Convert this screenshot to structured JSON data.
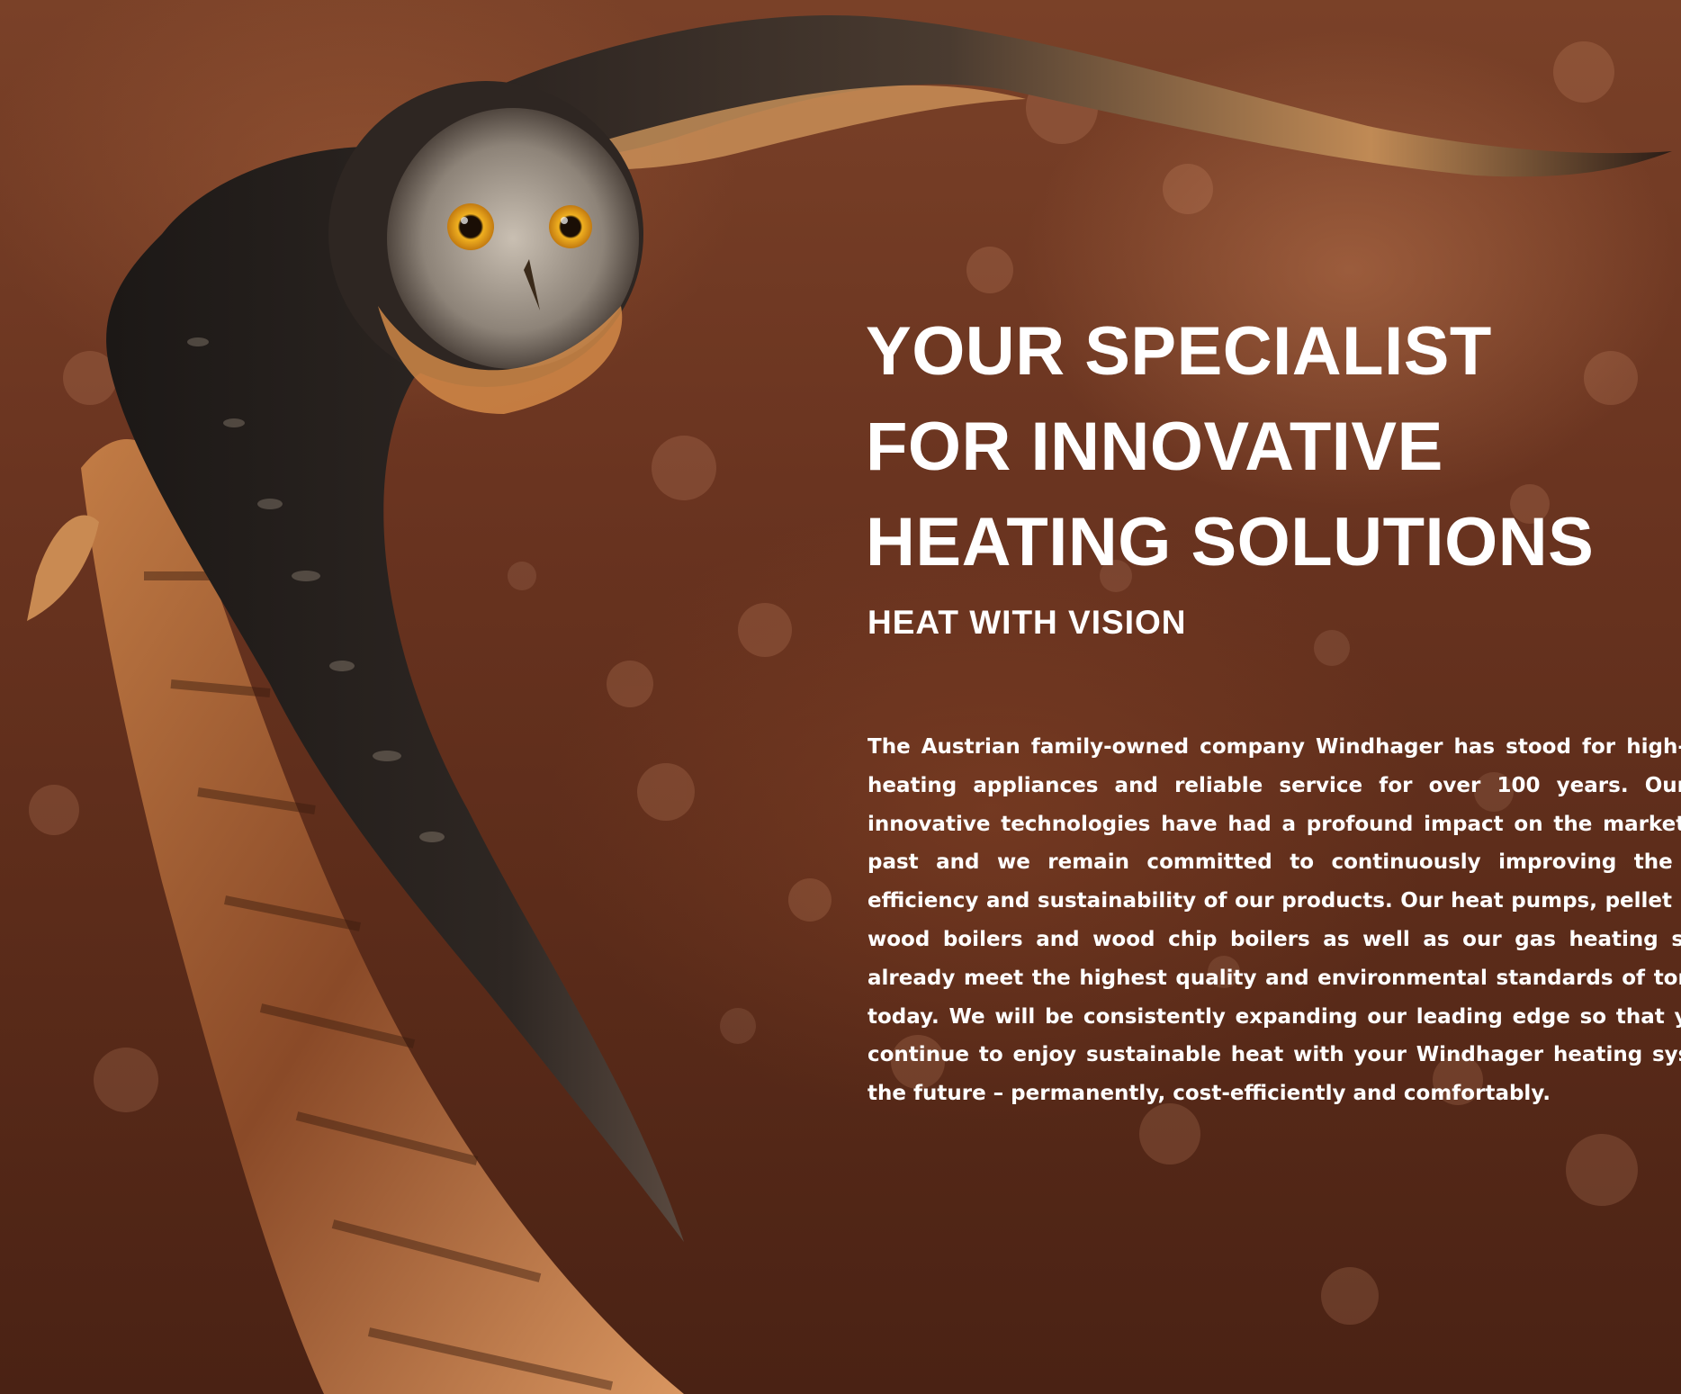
{
  "headline": {
    "line1": "YOUR SPECIALIST",
    "line2": "FOR INNOVATIVE",
    "line3": "HEATING SOLUTIONS"
  },
  "subheadline": "HEAT WITH VISION",
  "body": "The Austrian family-owned company Windhager has stood for high-quality heating appliances and reliable service for over 100 years. Our many innovative technologies have had a profound impact on the market in the past and we remain committed to continuously improving the power, efficiency and sustainability of our products. Our heat pumps, pellet boilers, wood boilers and wood chip boilers as well as our gas heating systems already meet the highest quality and environmental standards of tomorrow today. We will be consistently expanding our leading edge so that you can continue to enjoy sustainable heat with your Windhager heating system in the future – permanently, cost-efficiently and comfortably."
}
